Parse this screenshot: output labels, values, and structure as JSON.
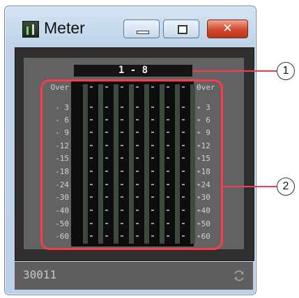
{
  "window": {
    "title": "Meter",
    "close_glyph": "✕",
    "app_icon": "meter-app-icon"
  },
  "meter": {
    "channel_range_label": "1 - 8",
    "channel_count": 8,
    "scale_labels": [
      "Over",
      "- 3",
      "- 6",
      "- 9",
      "-12",
      "-15",
      "-18",
      "-24",
      "-30",
      "-40",
      "-50",
      "-60"
    ]
  },
  "status": {
    "device_id": "30011",
    "refresh_icon": "refresh-icon"
  },
  "callouts": {
    "first": "1",
    "second": "2"
  },
  "colors": {
    "highlight": "#ff3b4b",
    "panel": "#2f2f2f",
    "meter_bg": "#0d0d0d"
  }
}
